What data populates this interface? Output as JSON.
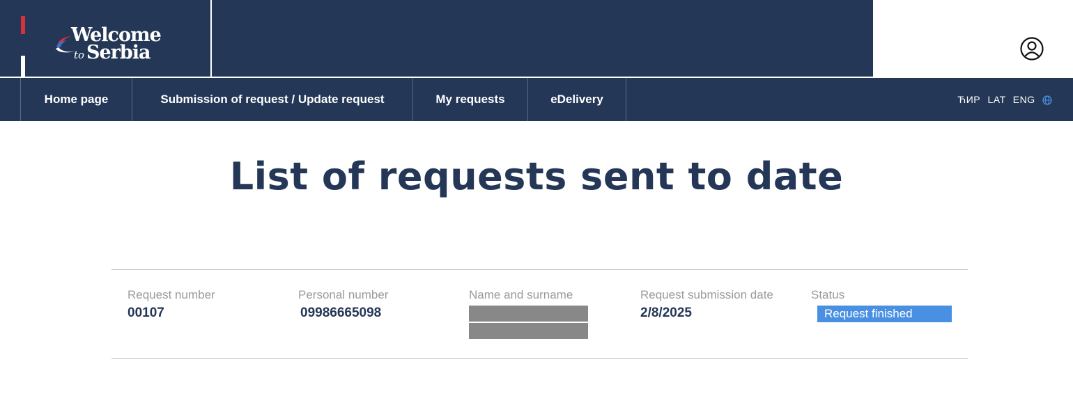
{
  "header": {
    "logo": {
      "word1": "Welcome",
      "word2": "Serbia",
      "to": "to"
    },
    "user_icon": "user-circle-icon"
  },
  "nav": {
    "items": [
      {
        "label": "Home page"
      },
      {
        "label": "Submission of request / Update request"
      },
      {
        "label": "My requests"
      },
      {
        "label": "eDelivery"
      }
    ],
    "languages": [
      "ЋИР",
      "LAT",
      "ENG"
    ],
    "globe_icon": "globe-icon"
  },
  "main": {
    "title": "List of requests sent to date",
    "columns": {
      "request_number": "Request number",
      "personal_number": "Personal number",
      "name": "Name and surname",
      "date": "Request submission date",
      "status": "Status"
    },
    "row": {
      "request_number": "00107",
      "personal_number": "09986665098",
      "date": "2/8/2025",
      "status": "Request finished"
    }
  },
  "colors": {
    "primary": "#243757",
    "accent_red": "#d7323c",
    "status_blue": "#4a90e2",
    "redaction": "#888888"
  }
}
